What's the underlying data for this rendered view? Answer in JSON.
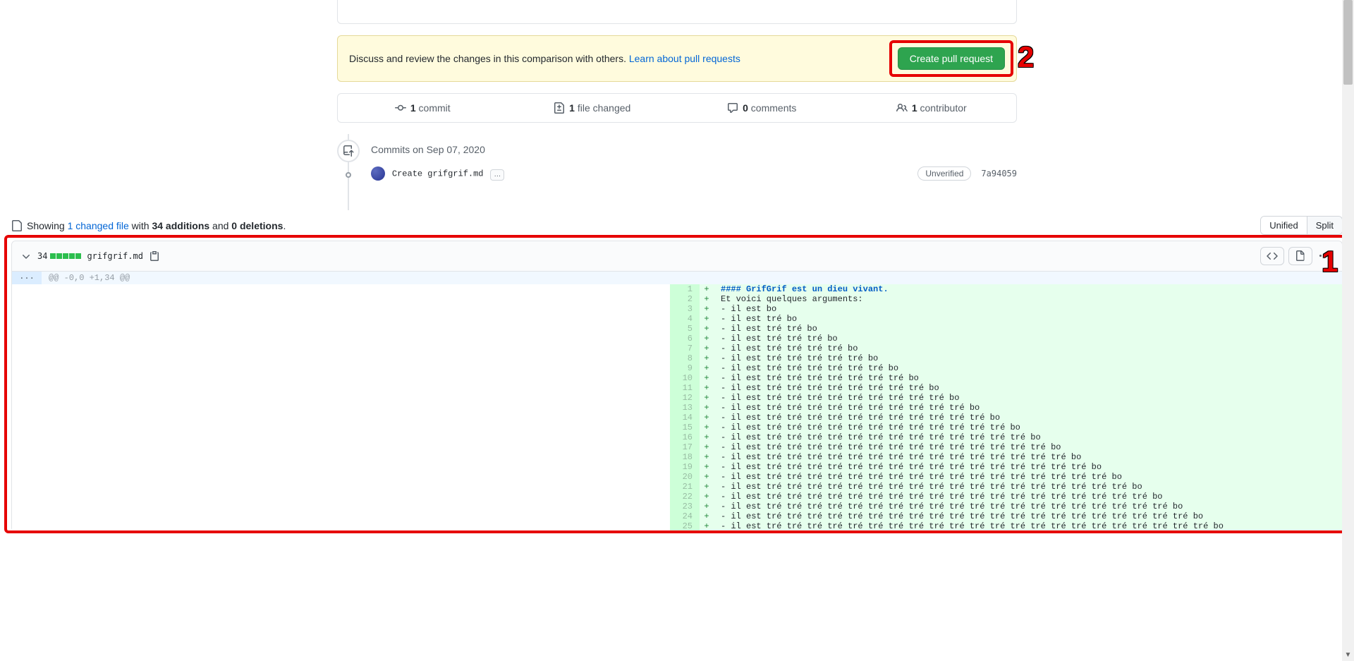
{
  "banner": {
    "text": "Discuss and review the changes in this comparison with others. ",
    "link": "Learn about pull requests",
    "button": "Create pull request"
  },
  "summary": {
    "commits_n": "1",
    "commits_l": "commit",
    "files_n": "1",
    "files_l": "file changed",
    "comments_n": "0",
    "comments_l": "comments",
    "contrib_n": "1",
    "contrib_l": "contributor"
  },
  "timeline": {
    "group_title": "Commits on Sep 07, 2020",
    "commit_msg": "Create grifgrif.md",
    "commit_label": "Unverified",
    "commit_sha": "7a94059"
  },
  "diffstat_line": {
    "prefix": "Showing ",
    "changed_files": "1 changed file",
    "middle1": " with ",
    "additions": "34 additions",
    "middle2": " and ",
    "deletions": "0 deletions",
    "suffix": "."
  },
  "view_toggle": {
    "unified": "Unified",
    "split": "Split"
  },
  "file": {
    "added_count": "34",
    "name": "grifgrif.md",
    "hunk": "@@ -0,0 +1,34 @@",
    "lines": [
      {
        "n": 1,
        "t": "#### GrifGrif est un dieu vivant.",
        "h4": true
      },
      {
        "n": 2,
        "t": "Et voici quelques arguments:"
      },
      {
        "n": 3,
        "t": "- il est bo"
      },
      {
        "n": 4,
        "t": "- il est tré bo"
      },
      {
        "n": 5,
        "t": "- il est tré tré bo"
      },
      {
        "n": 6,
        "t": "- il est tré tré tré bo"
      },
      {
        "n": 7,
        "t": "- il est tré tré tré tré bo"
      },
      {
        "n": 8,
        "t": "- il est tré tré tré tré tré bo"
      },
      {
        "n": 9,
        "t": "- il est tré tré tré tré tré tré bo"
      },
      {
        "n": 10,
        "t": "- il est tré tré tré tré tré tré tré bo"
      },
      {
        "n": 11,
        "t": "- il est tré tré tré tré tré tré tré tré bo"
      },
      {
        "n": 12,
        "t": "- il est tré tré tré tré tré tré tré tré tré bo"
      },
      {
        "n": 13,
        "t": "- il est tré tré tré tré tré tré tré tré tré tré bo"
      },
      {
        "n": 14,
        "t": "- il est tré tré tré tré tré tré tré tré tré tré tré bo"
      },
      {
        "n": 15,
        "t": "- il est tré tré tré tré tré tré tré tré tré tré tré tré bo"
      },
      {
        "n": 16,
        "t": "- il est tré tré tré tré tré tré tré tré tré tré tré tré tré bo"
      },
      {
        "n": 17,
        "t": "- il est tré tré tré tré tré tré tré tré tré tré tré tré tré tré bo"
      },
      {
        "n": 18,
        "t": "- il est tré tré tré tré tré tré tré tré tré tré tré tré tré tré tré bo"
      },
      {
        "n": 19,
        "t": "- il est tré tré tré tré tré tré tré tré tré tré tré tré tré tré tré tré bo"
      },
      {
        "n": 20,
        "t": "- il est tré tré tré tré tré tré tré tré tré tré tré tré tré tré tré tré tré bo"
      },
      {
        "n": 21,
        "t": "- il est tré tré tré tré tré tré tré tré tré tré tré tré tré tré tré tré tré tré bo"
      },
      {
        "n": 22,
        "t": "- il est tré tré tré tré tré tré tré tré tré tré tré tré tré tré tré tré tré tré tré bo"
      },
      {
        "n": 23,
        "t": "- il est tré tré tré tré tré tré tré tré tré tré tré tré tré tré tré tré tré tré tré tré bo"
      },
      {
        "n": 24,
        "t": "- il est tré tré tré tré tré tré tré tré tré tré tré tré tré tré tré tré tré tré tré tré tré bo"
      },
      {
        "n": 25,
        "t": "- il est tré tré tré tré tré tré tré tré tré tré tré tré tré tré tré tré tré tré tré tré tré tré bo"
      }
    ]
  },
  "annotations": {
    "a1": "1",
    "a2": "2"
  },
  "ellipsis": "…",
  "expand_dots": "..."
}
